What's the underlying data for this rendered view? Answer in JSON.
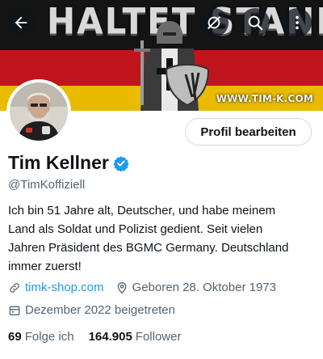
{
  "banner": {
    "title": "HALTET STAND!",
    "url_watermark": "WWW.TIM-K.COM",
    "colors": {
      "black": "#141414",
      "red": "#c0141c",
      "gold": "#e8bb00"
    }
  },
  "header_buttons": {
    "back_icon": "arrow-left-icon",
    "mute_icon": "bell-off-icon",
    "search_icon": "search-icon",
    "more_icon": "more-vertical-icon"
  },
  "profile": {
    "display_name": "Tim Kellner",
    "handle": "@TimKoffiziell",
    "verified": true,
    "edit_button": "Profil bearbeiten",
    "bio_lines": [
      "Ich bin 51 Jahre alt, Deutscher, und habe meinem",
      "Land als Soldat und Polizist gedient. Seit vielen",
      "Jahren Präsident des BGMC Germany. Deutschland",
      "immer zuerst!"
    ],
    "website": "timk-shop.com",
    "birthday": "Geboren 28. Oktober 1973",
    "joined": "Dezember 2022 beigetreten",
    "following_count": "69",
    "following_label": "Folge ich",
    "followers_count": "164.905",
    "followers_label": "Follower"
  },
  "colors": {
    "accent": "#1d9bf0",
    "text_primary": "#0f1419",
    "text_secondary": "#536471",
    "border": "#cfd9de"
  }
}
